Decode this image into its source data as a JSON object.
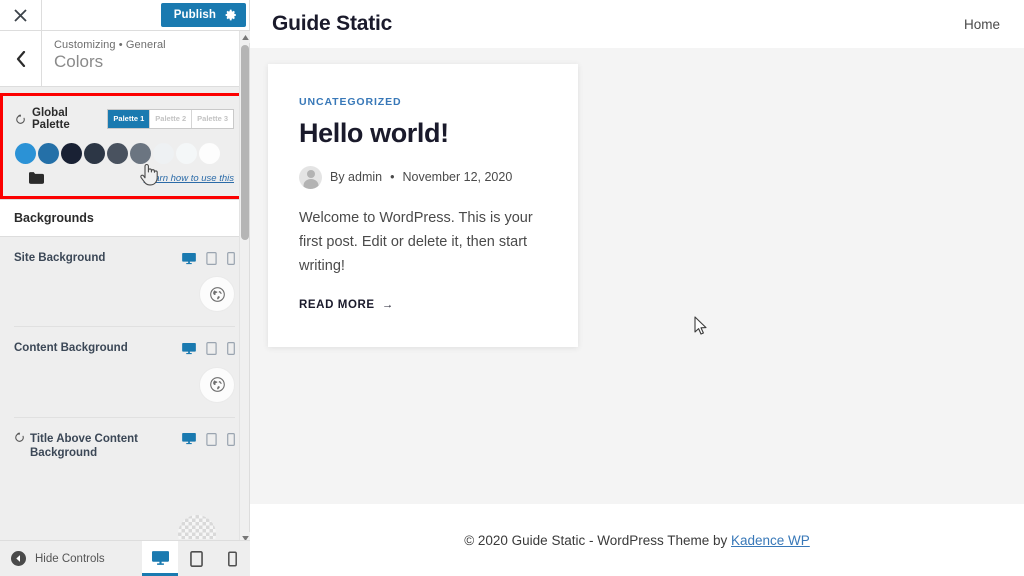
{
  "customizer": {
    "close_icon": "close-icon",
    "publish_label": "Publish",
    "publish_gear_icon": "gear-icon",
    "back_icon": "chevron-left-icon",
    "breadcrumb": "Customizing • General",
    "panel_title": "Colors"
  },
  "global_palette": {
    "reset_icon": "reset-icon",
    "label": "Global Palette",
    "tabs": [
      {
        "label": "Palette 1",
        "active": true
      },
      {
        "label": "Palette 2",
        "active": false
      },
      {
        "label": "Palette 3",
        "active": false
      }
    ],
    "swatches": [
      {
        "name": "color-1",
        "hex": "#2b92d6"
      },
      {
        "name": "color-2",
        "hex": "#2470a8"
      },
      {
        "name": "color-3",
        "hex": "#192134"
      },
      {
        "name": "color-4",
        "hex": "#2c3645"
      },
      {
        "name": "color-5",
        "hex": "#49525f"
      },
      {
        "name": "color-6",
        "hex": "#6b7581"
      },
      {
        "name": "color-7",
        "hex": "#eef1f3"
      },
      {
        "name": "color-8",
        "hex": "#f4f7f8"
      },
      {
        "name": "color-9",
        "hex": "#fdfdfd"
      }
    ],
    "folder_icon": "folder-icon",
    "learn_link": "Learn how to use this",
    "highlight_color": "#fc0000"
  },
  "backgrounds": {
    "section_title": "Backgrounds",
    "items": [
      {
        "label": "Site Background",
        "has_reset": false,
        "devices": [
          {
            "name": "desktop-icon",
            "active": true
          },
          {
            "name": "tablet-icon",
            "active": false
          },
          {
            "name": "mobile-icon",
            "active": false
          }
        ],
        "picker_icon": "globe-icon"
      },
      {
        "label": "Content Background",
        "has_reset": false,
        "devices": [
          {
            "name": "desktop-icon",
            "active": true
          },
          {
            "name": "tablet-icon",
            "active": false
          },
          {
            "name": "mobile-icon",
            "active": false
          }
        ],
        "picker_icon": "globe-icon"
      },
      {
        "label": "Title Above Content Background",
        "has_reset": true,
        "reset_icon": "reset-icon",
        "devices": [
          {
            "name": "desktop-icon",
            "active": true
          },
          {
            "name": "tablet-icon",
            "active": false
          },
          {
            "name": "mobile-icon",
            "active": false
          }
        ],
        "picker_icon": "transparent-swatch"
      }
    ]
  },
  "sidebar_bottom": {
    "collapse_icon": "collapse-icon",
    "hide_controls_label": "Hide Controls",
    "devices": [
      {
        "name": "desktop-preview-icon",
        "active": true
      },
      {
        "name": "tablet-preview-icon",
        "active": false
      },
      {
        "name": "mobile-preview-icon",
        "active": false
      }
    ]
  },
  "scrollbar": {
    "up_icon": "caret-up-icon",
    "down_icon": "caret-down-icon"
  },
  "preview": {
    "site_title": "Guide Static",
    "nav": [
      {
        "label": "Home"
      }
    ],
    "post": {
      "category": "UNCATEGORIZED",
      "title": "Hello world!",
      "author": "By admin",
      "meta_separator": "•",
      "date": "November 12, 2020",
      "excerpt": "Welcome to WordPress. This is your first post. Edit or delete it, then start writing!",
      "read_more": "READ MORE",
      "read_more_arrow": "→"
    },
    "footer": {
      "text": "© 2020 Guide Static - WordPress Theme by ",
      "link": "Kadence WP"
    }
  },
  "cursors": {
    "hand": "pointing-hand-cursor",
    "arrow": "arrow-cursor"
  }
}
